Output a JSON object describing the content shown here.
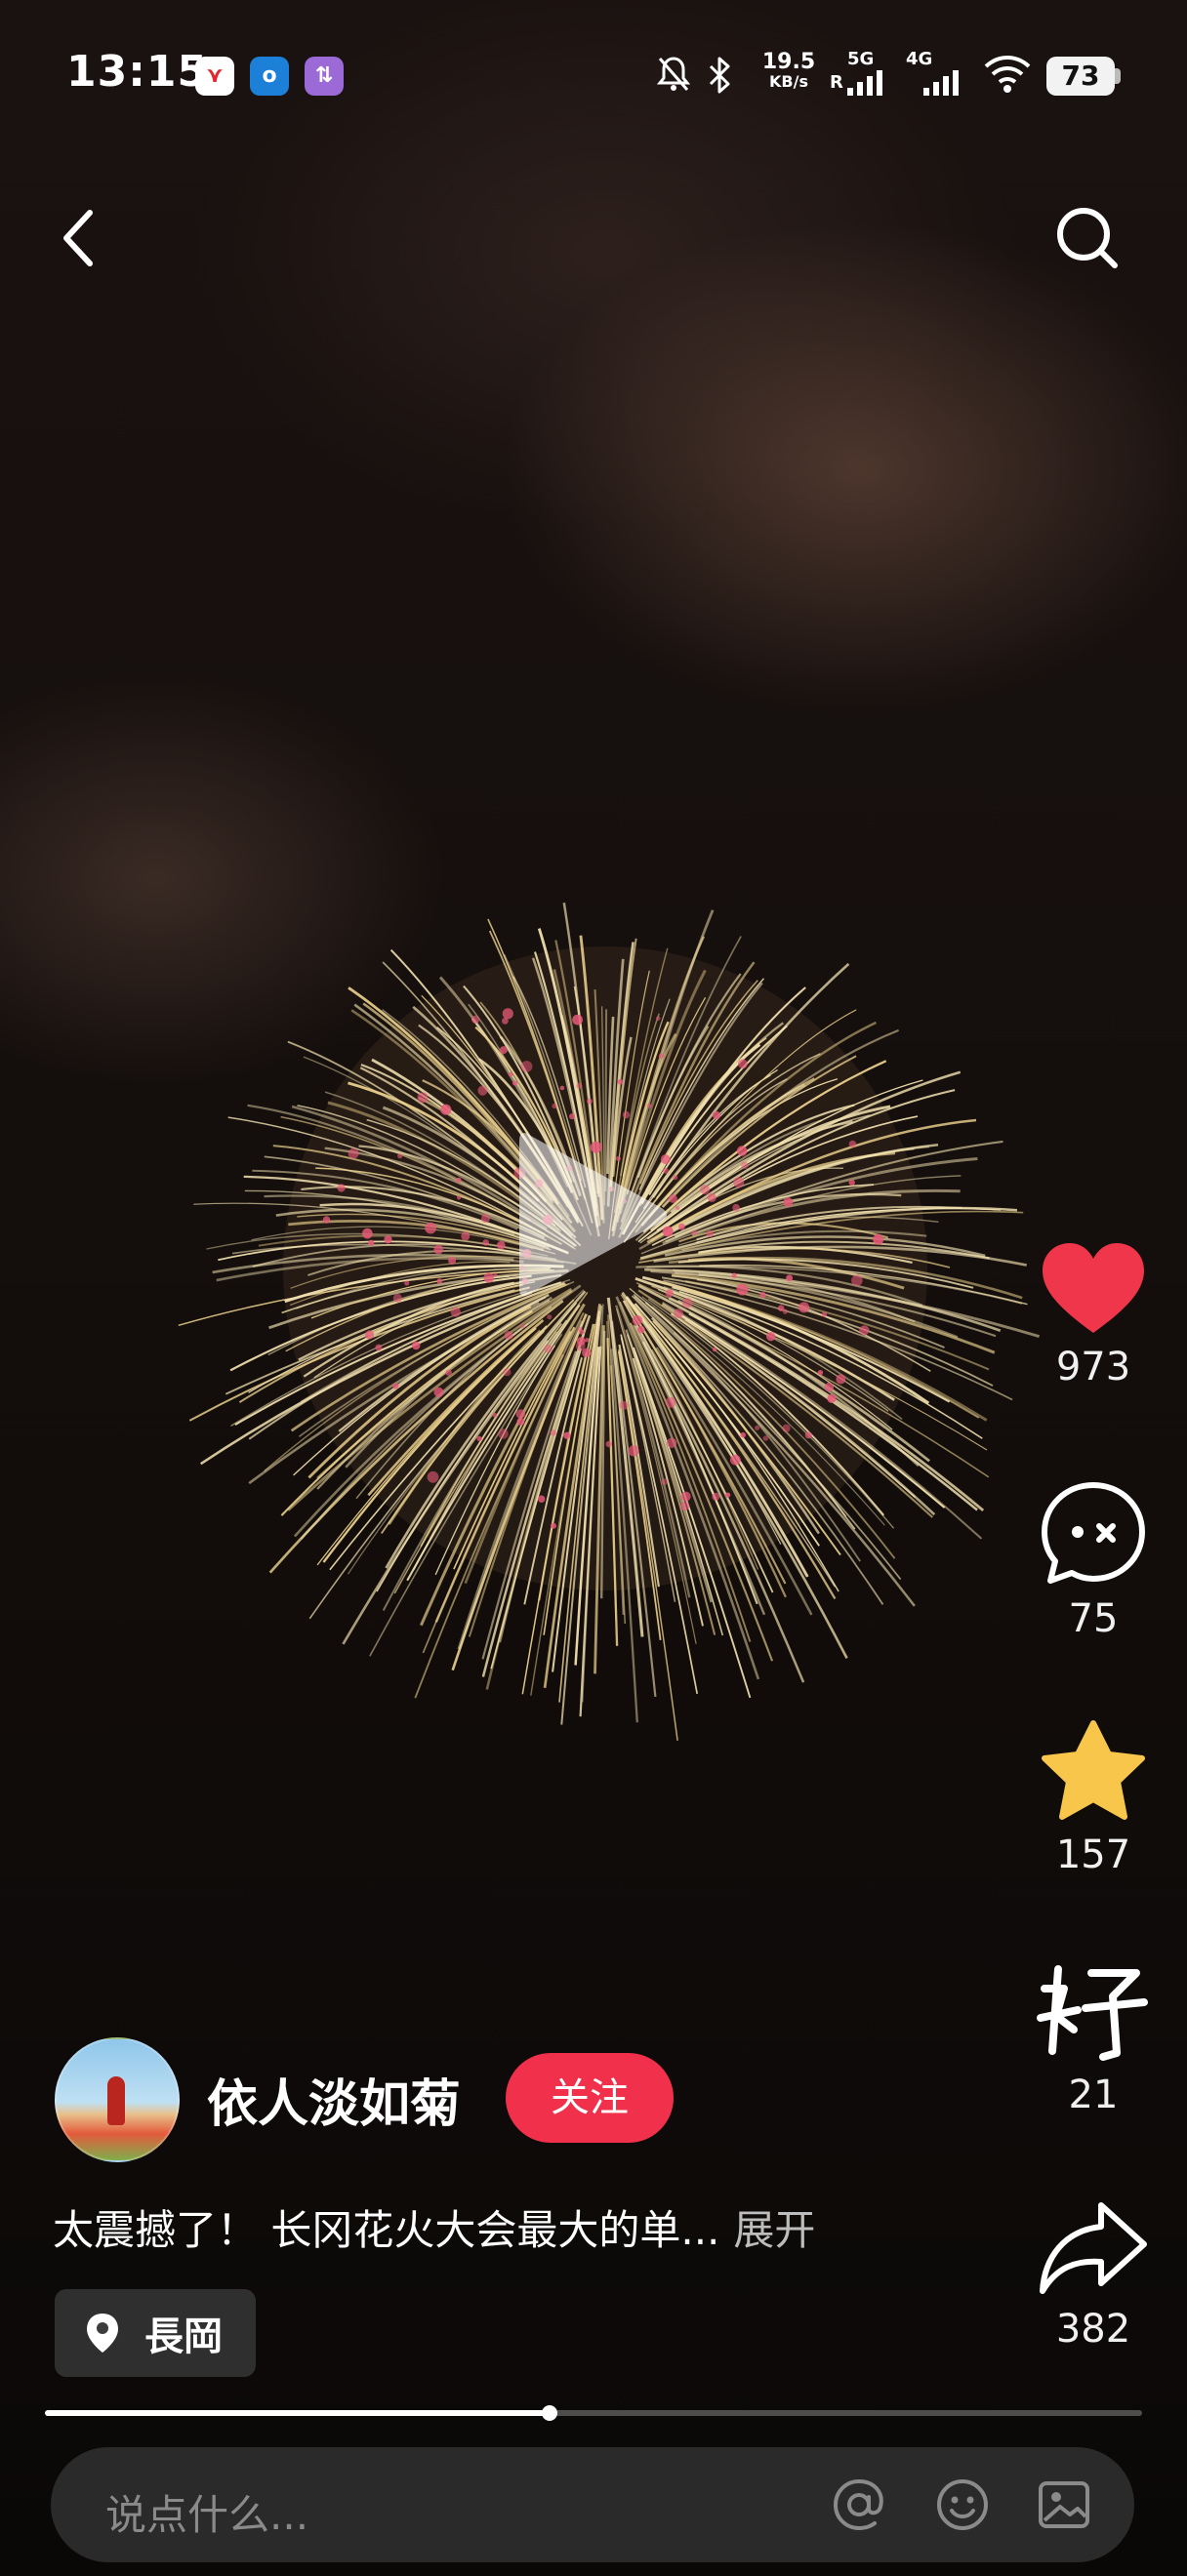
{
  "status_bar": {
    "time": "13:15",
    "net_speed_value": "19.5",
    "net_speed_unit": "KB/s",
    "sim1": "5G",
    "sim1_r": "R",
    "sim2": "4G",
    "battery": "73",
    "app_icons": [
      "news-app-icon",
      "outlook-icon",
      "transfer-app-icon"
    ]
  },
  "video": {
    "paused": true,
    "progress": 0.46
  },
  "actions": {
    "likes": "973",
    "comments": "75",
    "favorites": "157",
    "good": "21",
    "shares": "382",
    "like_color": "#f0364a",
    "favorite_color": "#f7c64b"
  },
  "author": {
    "name": "依人淡如菊",
    "follow_label": "关注"
  },
  "post": {
    "caption": "太震撼了！ 长冈花火大会最大的单...",
    "expand_label": "展开",
    "location": "長岡"
  },
  "comment_bar": {
    "placeholder": "说点什么..."
  }
}
